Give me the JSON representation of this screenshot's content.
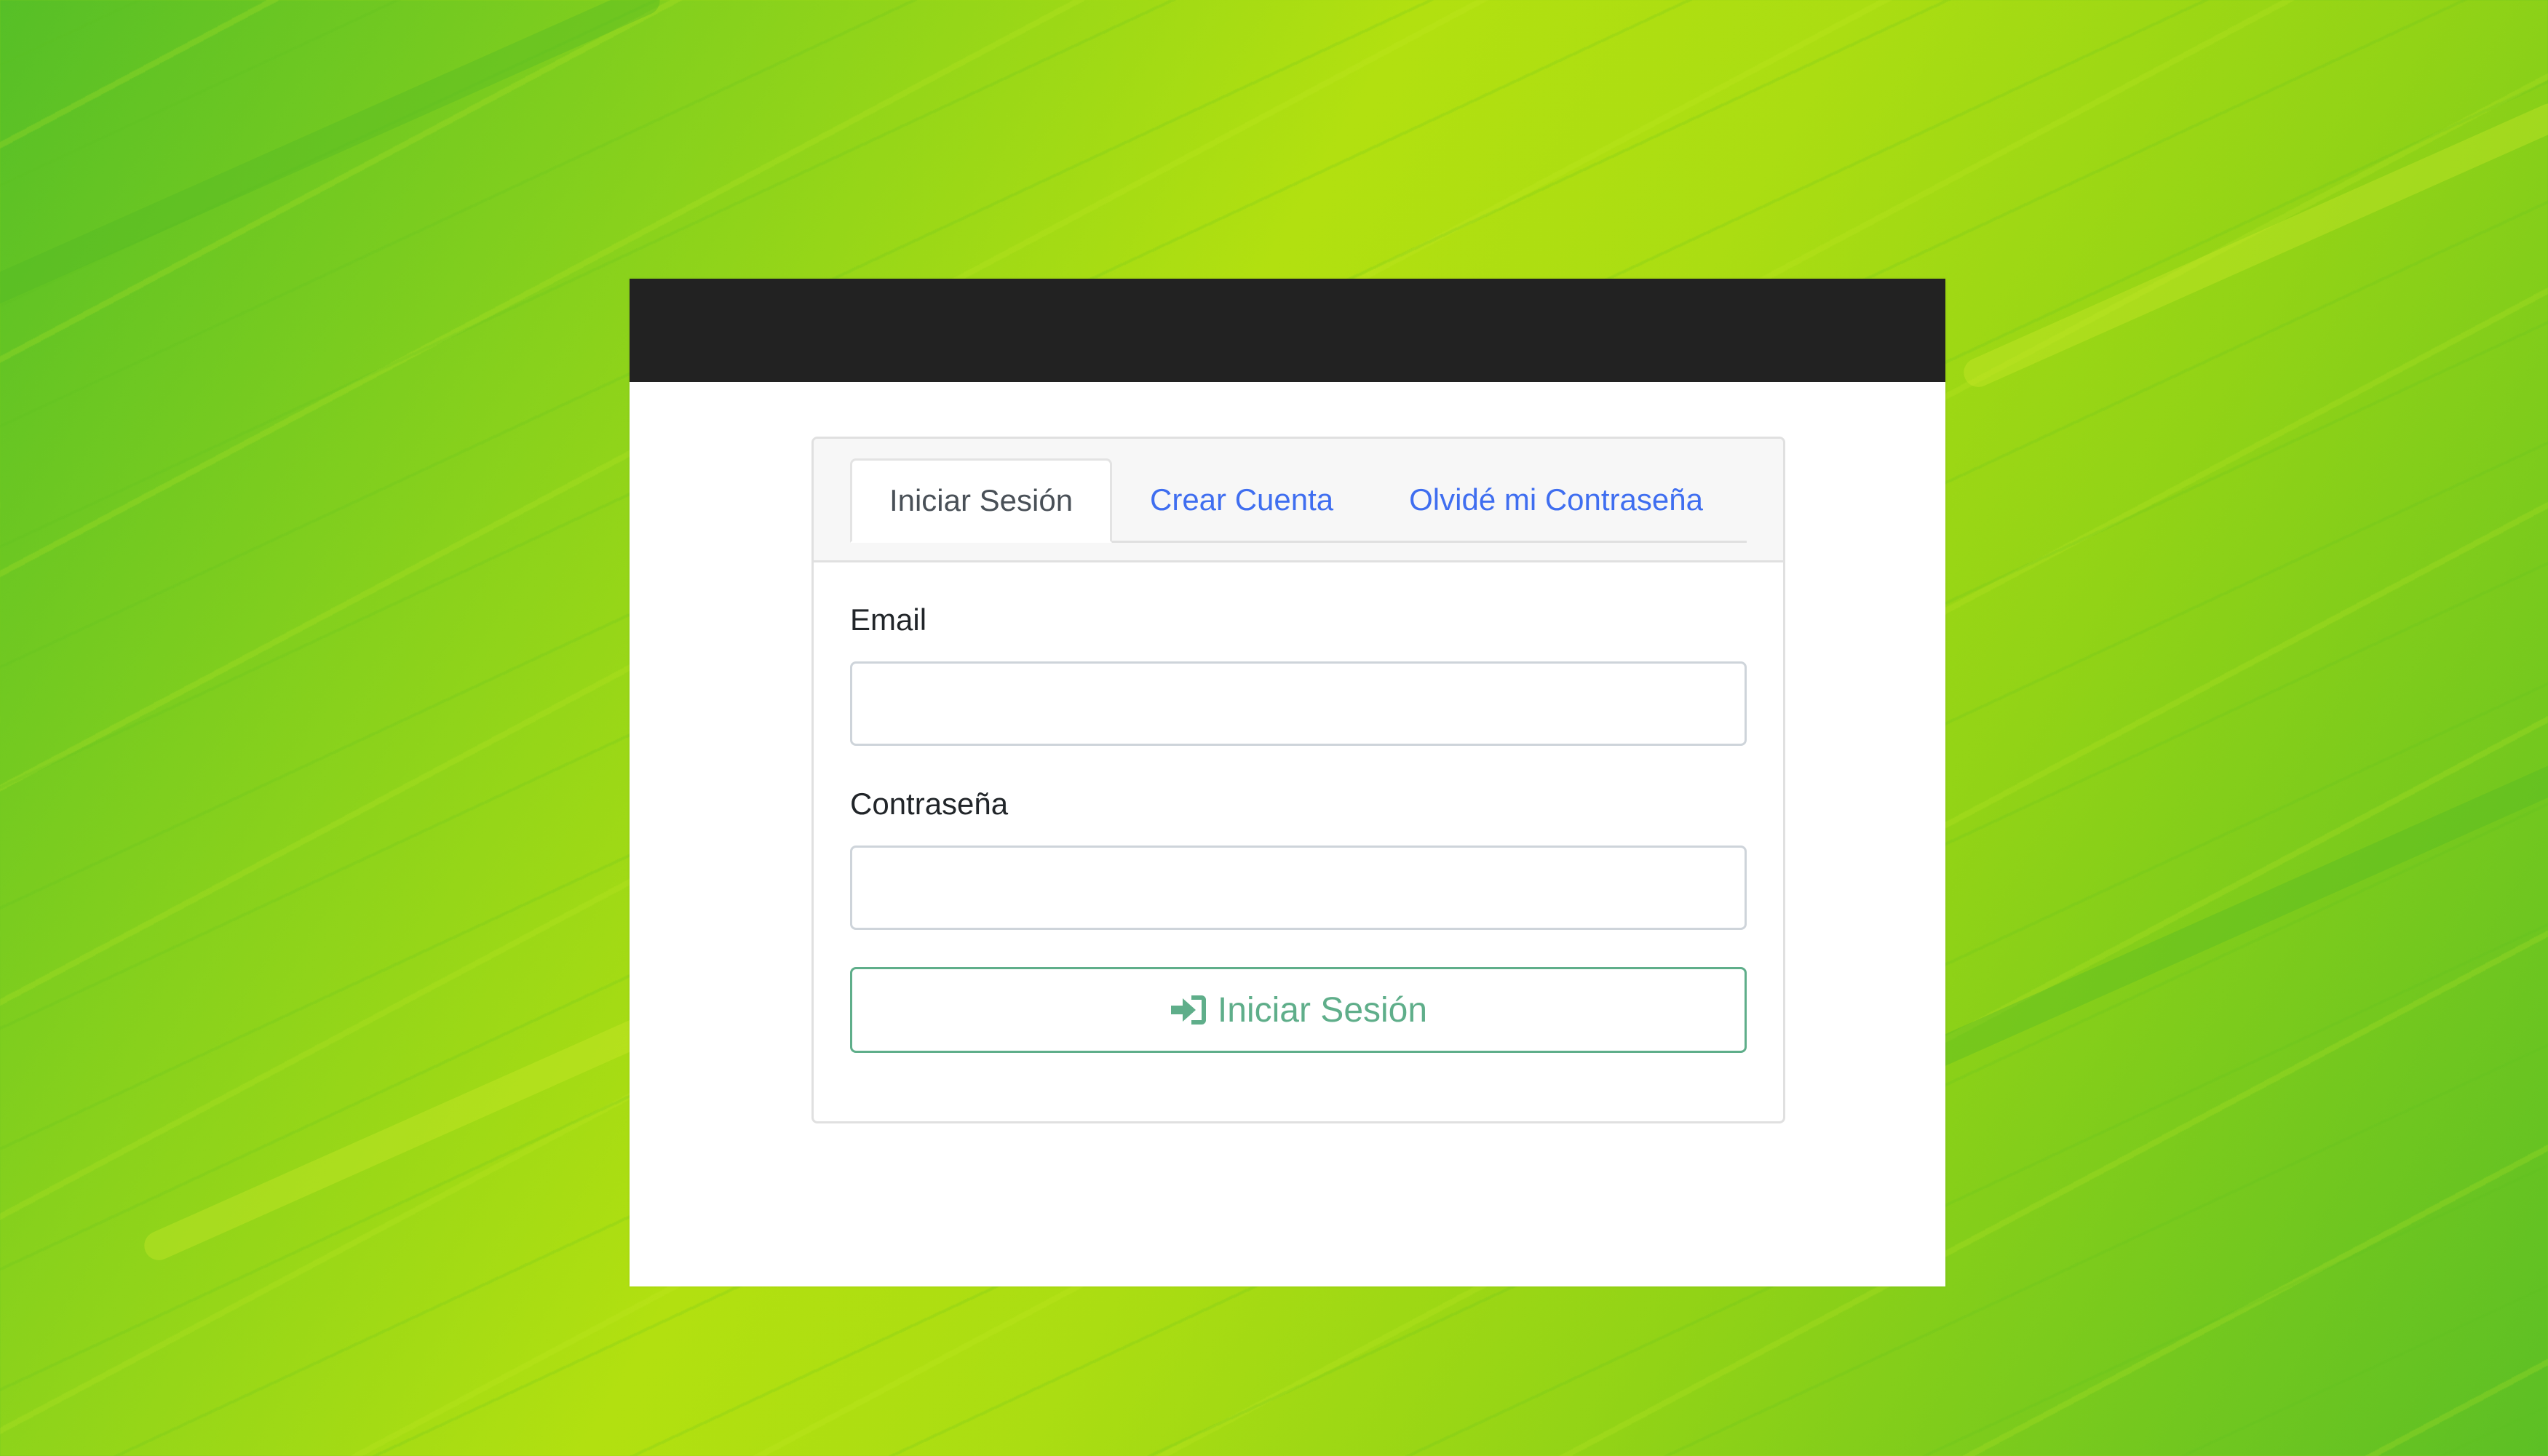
{
  "tabs": [
    {
      "label": "Iniciar Sesión",
      "active": true
    },
    {
      "label": "Crear Cuenta",
      "active": false
    },
    {
      "label": "Olvidé mi Contraseña",
      "active": false
    }
  ],
  "form": {
    "email_label": "Email",
    "email_value": "",
    "password_label": "Contraseña",
    "password_value": "",
    "submit_label": "Iniciar Sesión",
    "submit_icon": "sign-in-icon"
  },
  "colors": {
    "header_bar": "#222222",
    "tab_link": "#3f6ef0",
    "button_outline": "#5fae8a",
    "background_green": "#8fd418"
  }
}
